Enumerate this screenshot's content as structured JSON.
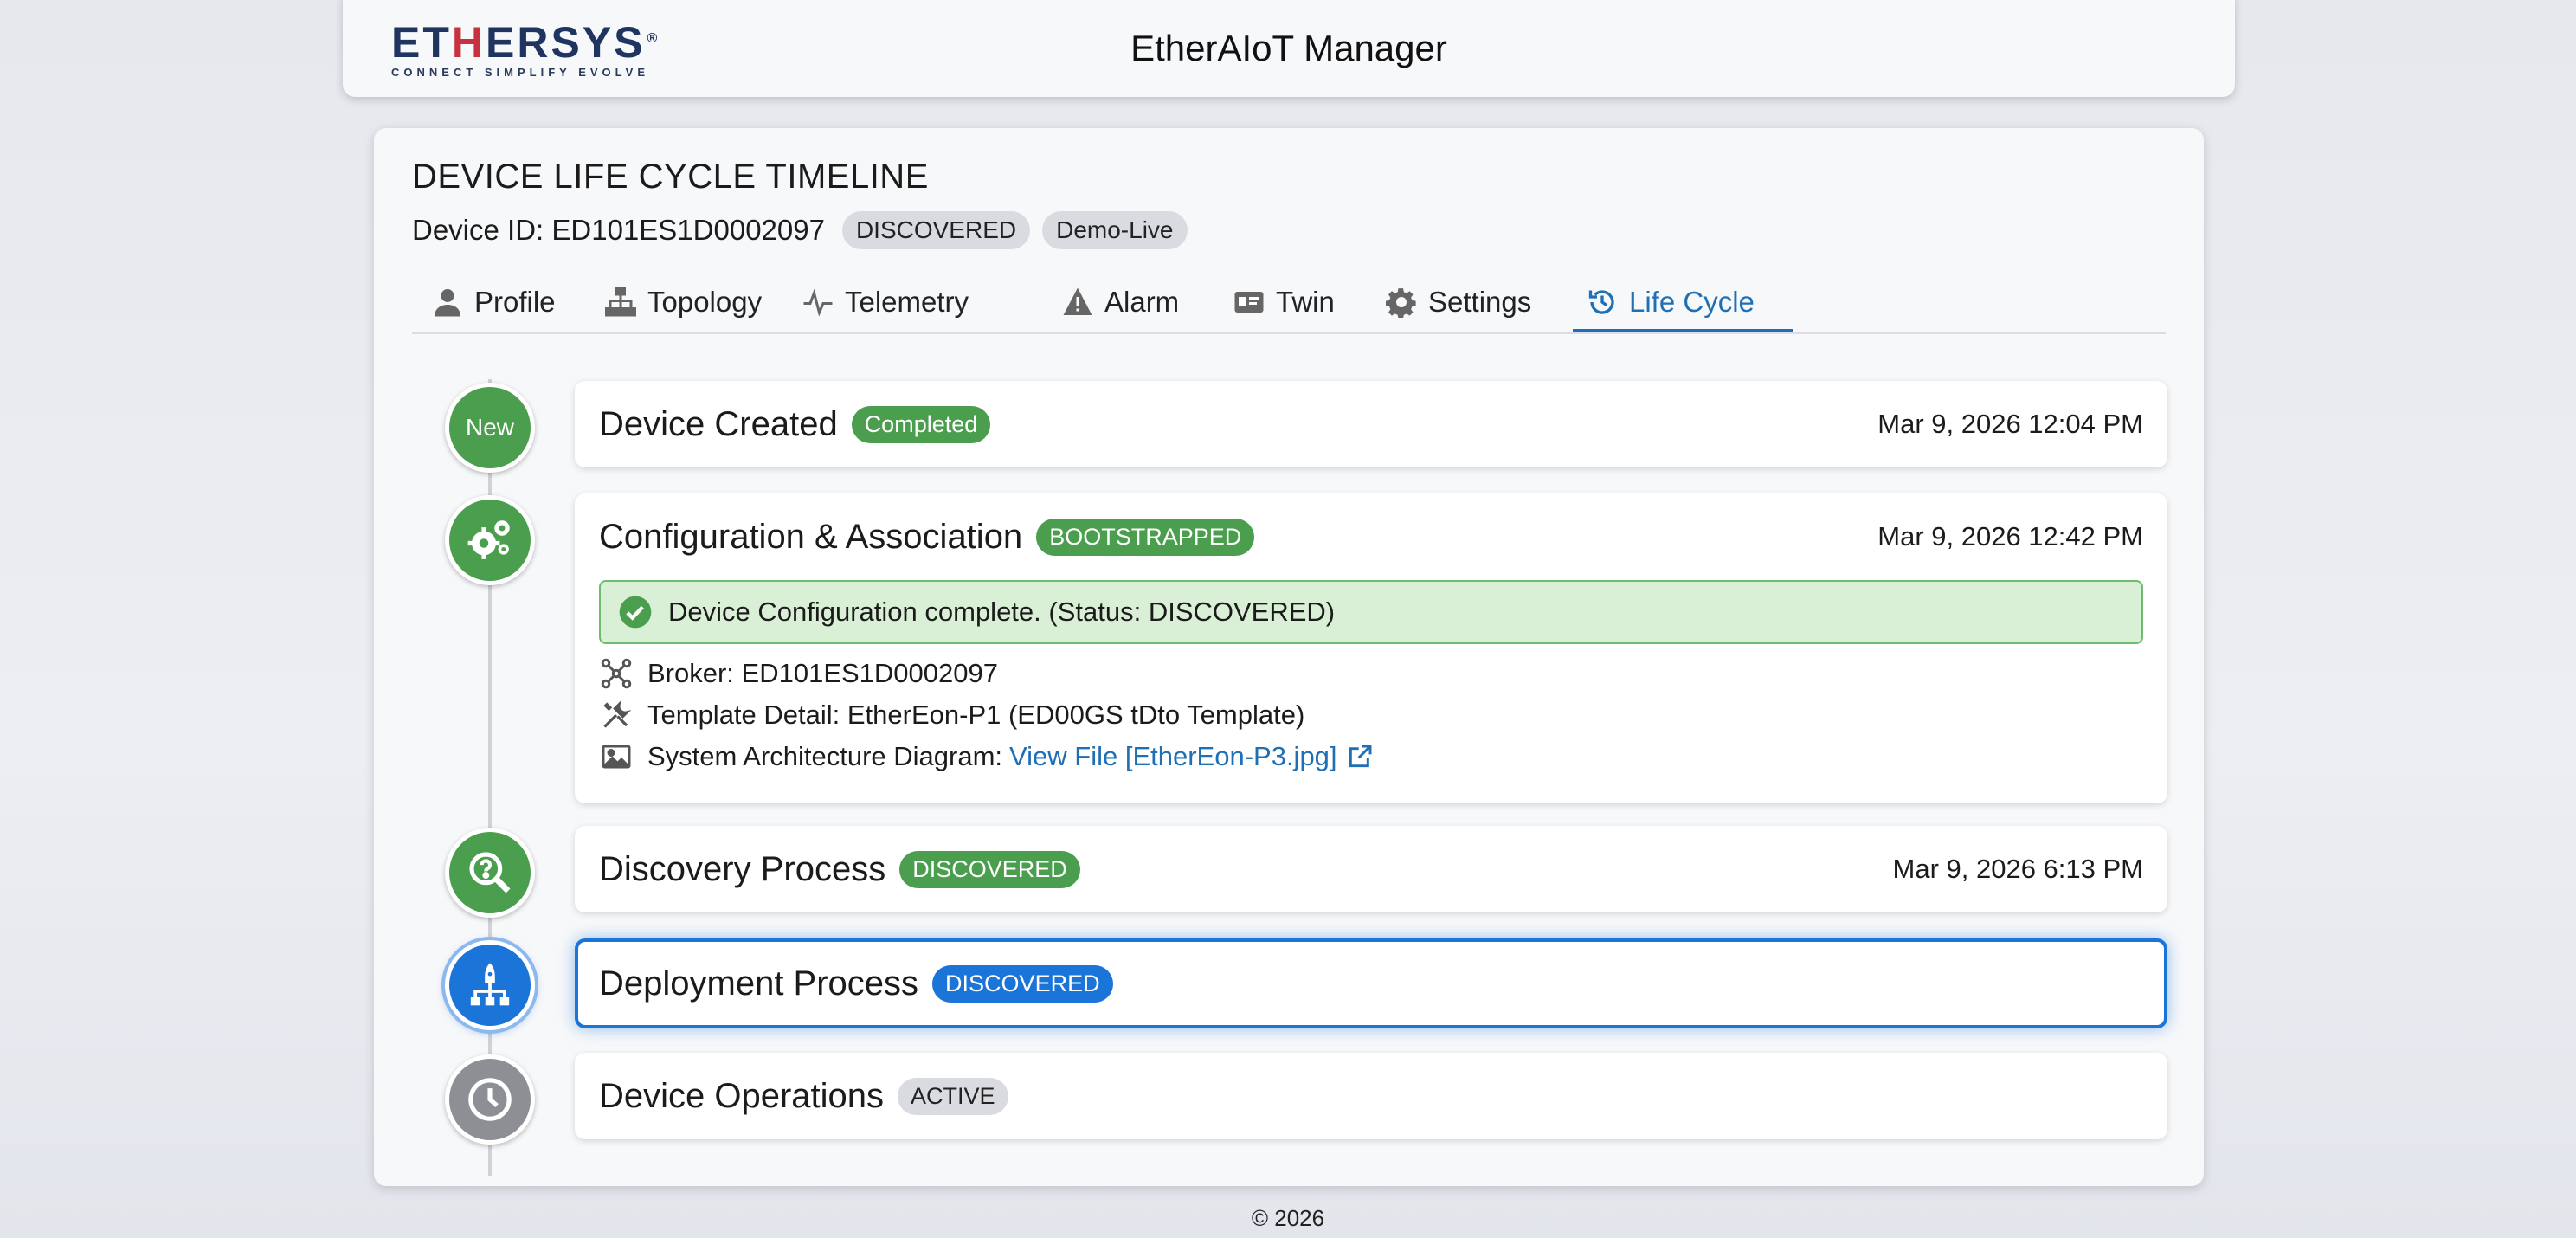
{
  "header": {
    "logo_pre": "ET",
    "logo_h": "H",
    "logo_mid": "ERSYS",
    "logo_reg": "®",
    "logo_tagline": "CONNECT SIMPLIFY EVOLVE",
    "app_title": "EtherAIoT Manager"
  },
  "page": {
    "title": "DEVICE LIFE CYCLE TIMELINE",
    "device_id_label": "Device ID: ED101ES1D0002097",
    "status_pill": "DISCOVERED",
    "env_pill": "Demo-Live"
  },
  "tabs": [
    {
      "label": "Profile",
      "icon": "user-icon"
    },
    {
      "label": "Topology",
      "icon": "sitemap-icon"
    },
    {
      "label": "Telemetry",
      "icon": "pulse-icon"
    },
    {
      "label": "Alarm",
      "icon": "warning-icon"
    },
    {
      "label": "Twin",
      "icon": "id-card-icon"
    },
    {
      "label": "Settings",
      "icon": "gear-icon"
    },
    {
      "label": "Life Cycle",
      "icon": "history-icon",
      "active": true
    }
  ],
  "steps": [
    {
      "node_label": "New",
      "title": "Device Created",
      "badge": "Completed",
      "time": "Mar 9, 2026 12:04 PM"
    },
    {
      "title": "Configuration & Association",
      "badge": "BOOTSTRAPPED",
      "time": "Mar 9, 2026 12:42 PM",
      "message": "Device Configuration complete. (Status: DISCOVERED)",
      "broker": "Broker: ED101ES1D0002097",
      "template": "Template Detail: EtherEon-P1 (ED00GS tDto Template)",
      "diagram_label": "System Architecture Diagram:",
      "diagram_link": "View File [EtherEon-P3.jpg]"
    },
    {
      "title": "Discovery Process",
      "badge": "DISCOVERED",
      "time": "Mar 9, 2026 6:13 PM"
    },
    {
      "title": "Deployment Process",
      "badge": "DISCOVERED"
    },
    {
      "title": "Device Operations",
      "badge": "ACTIVE"
    }
  ],
  "colors": {
    "green": "#4a9e4e",
    "blue": "#1b74d8",
    "grey": "#8d8f94",
    "link": "#1f6fb5"
  },
  "footer": "© 2026"
}
